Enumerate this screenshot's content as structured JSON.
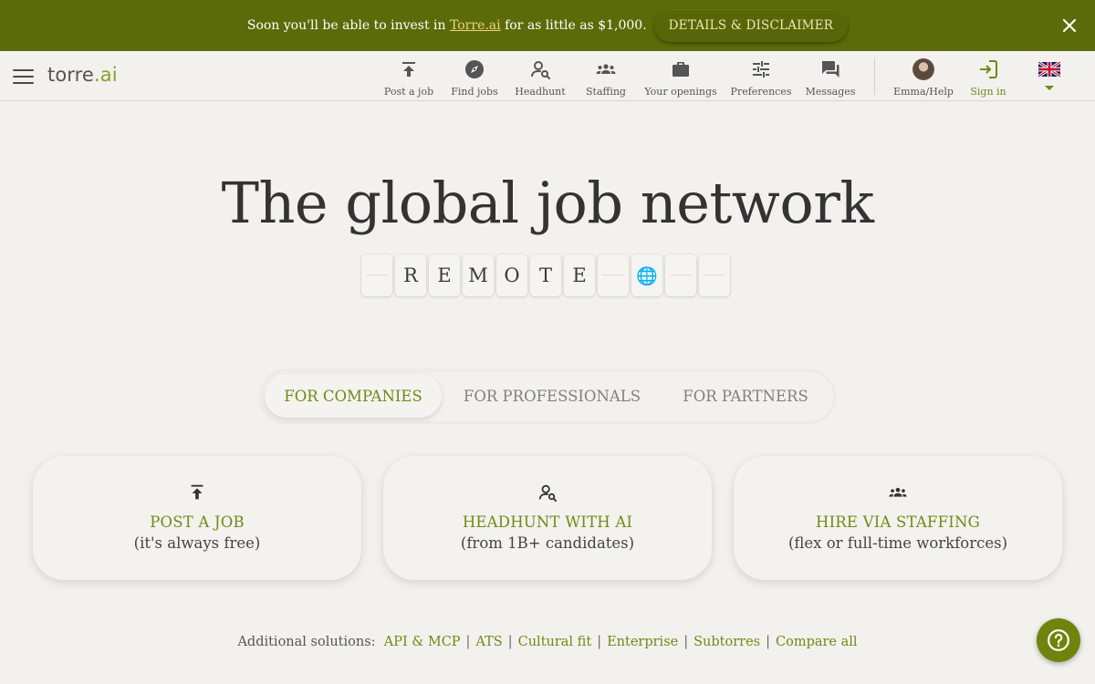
{
  "banner": {
    "text_before": "Soon you'll be able to invest in ",
    "link": "Torre.ai",
    "text_after": " for as little as $1,000.",
    "button": "DETAILS & DISCLAIMER",
    "close_icon": "close-icon",
    "bg_color": "#5c6b0a"
  },
  "header": {
    "logo_main": "torre",
    "logo_suffix": ".ai",
    "nav": [
      {
        "label": "Post a job",
        "icon": "upload-arrow-icon"
      },
      {
        "label": "Find jobs",
        "icon": "compass-icon"
      },
      {
        "label": "Headhunt",
        "icon": "person-search-icon"
      },
      {
        "label": "Staffing",
        "icon": "group-icon"
      },
      {
        "label": "Your openings",
        "icon": "briefcase-icon"
      },
      {
        "label": "Preferences",
        "icon": "sliders-icon"
      },
      {
        "label": "Messages",
        "icon": "chat-icon"
      },
      {
        "label": "Emma/Help",
        "icon": "avatar"
      },
      {
        "label": "Sign in",
        "icon": "login-icon"
      }
    ],
    "language_flag": "uk-flag-icon"
  },
  "hero": {
    "title": "The global job network",
    "tiles": [
      "",
      "R",
      "E",
      "M",
      "O",
      "T",
      "E",
      "",
      "🌐",
      "",
      ""
    ]
  },
  "tabs": [
    {
      "label": "FOR COMPANIES",
      "active": true
    },
    {
      "label": "FOR PROFESSIONALS",
      "active": false
    },
    {
      "label": "FOR PARTNERS",
      "active": false
    }
  ],
  "cards": [
    {
      "title": "POST A JOB",
      "subtitle": "(it's always free)",
      "icon": "upload-arrow-icon"
    },
    {
      "title": "HEADHUNT WITH AI",
      "subtitle": "(from 1B+ candidates)",
      "icon": "person-search-icon"
    },
    {
      "title": "HIRE VIA STAFFING",
      "subtitle": "(flex or full-time workforces)",
      "icon": "group-icon"
    }
  ],
  "solutions": {
    "label": "Additional solutions:",
    "links": [
      "API & MCP",
      "ATS",
      "Cultural fit",
      "Enterprise",
      "Subtorres",
      "Compare all"
    ]
  },
  "help_button": {
    "icon": "help-icon"
  },
  "colors": {
    "accent": "#6f8a14",
    "background": "#f2f1ee",
    "banner": "#5c6b0a"
  }
}
